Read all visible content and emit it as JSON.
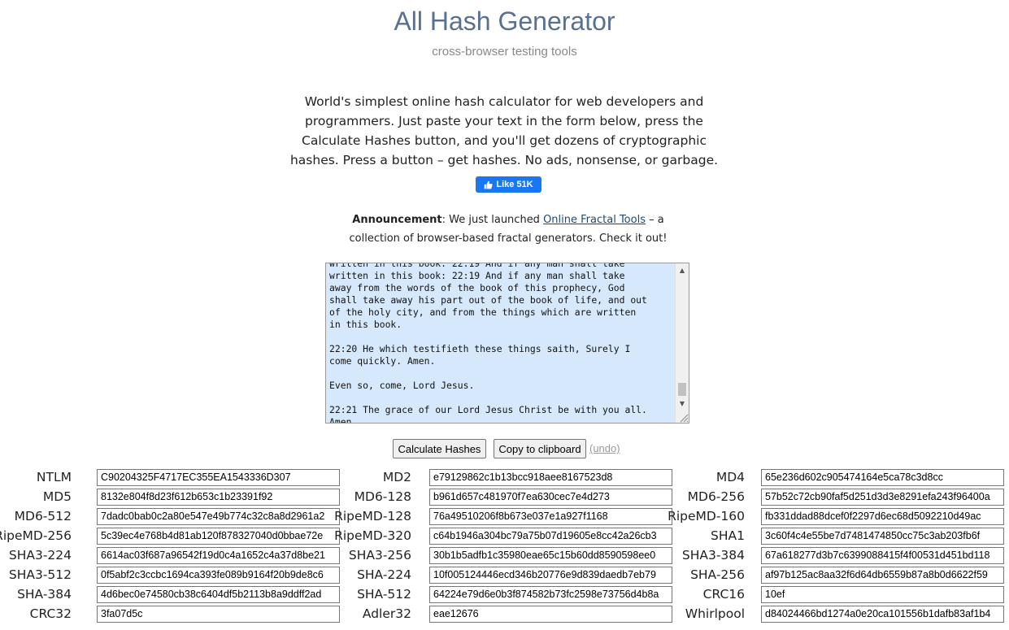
{
  "header": {
    "title": "All Hash Generator",
    "subtitle": "cross-browser testing tools"
  },
  "intro": "World's simplest online hash calculator for web developers and programmers. Just paste your text in the form below, press the Calculate Hashes button, and you'll get dozens of cryptographic hashes. Press a button – get hashes. No ads, nonsense, or garbage.",
  "like_button": {
    "label": "Like 51K",
    "icon": "thumbs-up-icon"
  },
  "announcement": {
    "label": "Announcement",
    "before": ": We just launched ",
    "link_text": "Online Fractal Tools",
    "after": " – a collection of browser-based fractal generators. Check it out!"
  },
  "input_text": "written in this book: 22:19 And if any man shall take\nwritten in this book: 22:19 And if any man shall take\naway from the words of the book of this prophecy, God\nshall take away his part out of the book of life, and out\nof the holy city, and from the things which are written\nin this book.\n\n22:20 He which testifieth these things saith, Surely I\ncome quickly. Amen.\n\nEven so, come, Lord Jesus.\n\n22:21 The grace of our Lord Jesus Christ be with you all.\nAmen.",
  "buttons": {
    "calculate": "Calculate Hashes",
    "copy": "Copy to clipboard",
    "undo": "(undo)"
  },
  "hashes": [
    {
      "label": "NTLM",
      "value": "C90204325F4717EC355EA1543336D307"
    },
    {
      "label": "MD2",
      "value": "e79129862c1b13bcc918aee8167523d8"
    },
    {
      "label": "MD4",
      "value": "65e236d602c905474164e5ca78c3d8cc"
    },
    {
      "label": "MD5",
      "value": "8132e804f8d23f612b653c1b23391f92"
    },
    {
      "label": "MD6-128",
      "value": "b961d657c481970f7ea630cec7e4d273"
    },
    {
      "label": "MD6-256",
      "value": "57b52c72cb90faf5d251d3d3e8291efa243f96400a"
    },
    {
      "label": "MD6-512",
      "value": "7dadc0bab0c2a80e547e49b774c32c8a8d2961a2"
    },
    {
      "label": "RipeMD-128",
      "value": "76a49510206f8b673e037e1a927f1168"
    },
    {
      "label": "RipeMD-160",
      "value": "fb331ddad88dcef0f2297d6ec68d5092210d49ac"
    },
    {
      "label": "RipeMD-256",
      "value": "5c39ec4e768b4d81ab120f878327040d0bbae72e"
    },
    {
      "label": "RipeMD-320",
      "value": "c64b1946a304bc79a75b07d19605e8cc42a26cb3"
    },
    {
      "label": "SHA1",
      "value": "3c60f4c4e55be7d7481474850cc75c3ab203fb6f"
    },
    {
      "label": "SHA3-224",
      "value": "6614ac03f687a96542f19d0c4a1652c4a37d8be21"
    },
    {
      "label": "SHA3-256",
      "value": "30b1b5adfb1c35980eae65c15b60dd8590598ee0"
    },
    {
      "label": "SHA3-384",
      "value": "67a618277d3b7c6399088415f4f00531d451bd118"
    },
    {
      "label": "SHA3-512",
      "value": "0f5abf2c3ccbc1694ca393fe089b9164f20b9de8c6"
    },
    {
      "label": "SHA-224",
      "value": "10f005124446ecd346b20776e9d839daedb7eb79"
    },
    {
      "label": "SHA-256",
      "value": "af97b125ac8aa32f6d64db6559b87a8b0d6622f59"
    },
    {
      "label": "SHA-384",
      "value": "4d6bec0e74580cb38c6404df5b2113b8a9ddff2ad"
    },
    {
      "label": "SHA-512",
      "value": "64224e79d6e0b3f874582b73fc2598e73756d4b8a"
    },
    {
      "label": "CRC16",
      "value": "10ef"
    },
    {
      "label": "CRC32",
      "value": "3fa07d5c"
    },
    {
      "label": "Adler32",
      "value": "eae12676"
    },
    {
      "label": "Whirlpool",
      "value": "d84024466bd1274a0e20ca101556b1dafb83af1b4"
    }
  ]
}
